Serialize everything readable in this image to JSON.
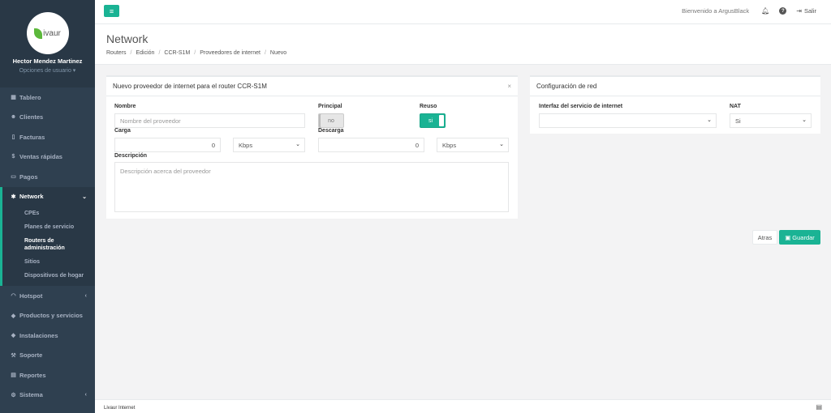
{
  "sidebar": {
    "logo_text": "ivaur",
    "user_name": "Hector Mendez Martinez",
    "user_options": "Opciones de usuario ▾",
    "items": [
      {
        "icon": "dashboard-icon",
        "label": "Tablero"
      },
      {
        "icon": "users-icon",
        "label": "Clientes"
      },
      {
        "icon": "file-icon",
        "label": "Facturas"
      },
      {
        "icon": "dollar-icon",
        "label": "Ventas rápidas"
      },
      {
        "icon": "money-icon",
        "label": "Pagos"
      },
      {
        "icon": "network-icon",
        "label": "Network"
      }
    ],
    "subitems": [
      "CPEs",
      "Planes de servicio",
      "Routers de administración",
      "Sitios",
      "Dispositivos de hogar"
    ],
    "items_after": [
      {
        "icon": "wifi-icon",
        "label": "Hotspot"
      },
      {
        "icon": "tags-icon",
        "label": "Productos y servicios"
      },
      {
        "icon": "tag-icon",
        "label": "Instalaciones"
      },
      {
        "icon": "wrench-icon",
        "label": "Soporte"
      },
      {
        "icon": "book-icon",
        "label": "Reportes"
      },
      {
        "icon": "cogs-icon",
        "label": "Sistema"
      }
    ]
  },
  "topbar": {
    "welcome": "Bienvenido a ArgusBlack",
    "logout": "Salir"
  },
  "heading": {
    "title": "Network",
    "breadcrumb": [
      "Routers",
      "Edición",
      "CCR-S1M",
      "Proveedores de internet",
      "Nuevo"
    ]
  },
  "provider_panel": {
    "title": "Nuevo proveedor de internet para el router CCR-S1M",
    "nombre_label": "Nombre",
    "nombre_placeholder": "Nombre del proveedor",
    "principal_label": "Principal",
    "principal_value": "no",
    "reuso_label": "Reuso",
    "reuso_value": "si",
    "carga_label": "Carga",
    "carga_value": "0",
    "carga_unit": "Kbps",
    "descarga_label": "Descarga",
    "descarga_value": "0",
    "descarga_unit": "Kbps",
    "descripcion_label": "Descripción",
    "descripcion_placeholder": "Descripción acerca del proveedor"
  },
  "network_panel": {
    "title": "Configuración de red",
    "interface_label": "Interfaz del servicio de internet",
    "interface_value": "",
    "nat_label": "NAT",
    "nat_value": "Si"
  },
  "actions": {
    "back": "Atras",
    "save": "Guardar"
  },
  "footer": {
    "text": "Livaur Internet"
  },
  "colors": {
    "accent": "#1ab394",
    "sidebar": "#2f4050"
  }
}
